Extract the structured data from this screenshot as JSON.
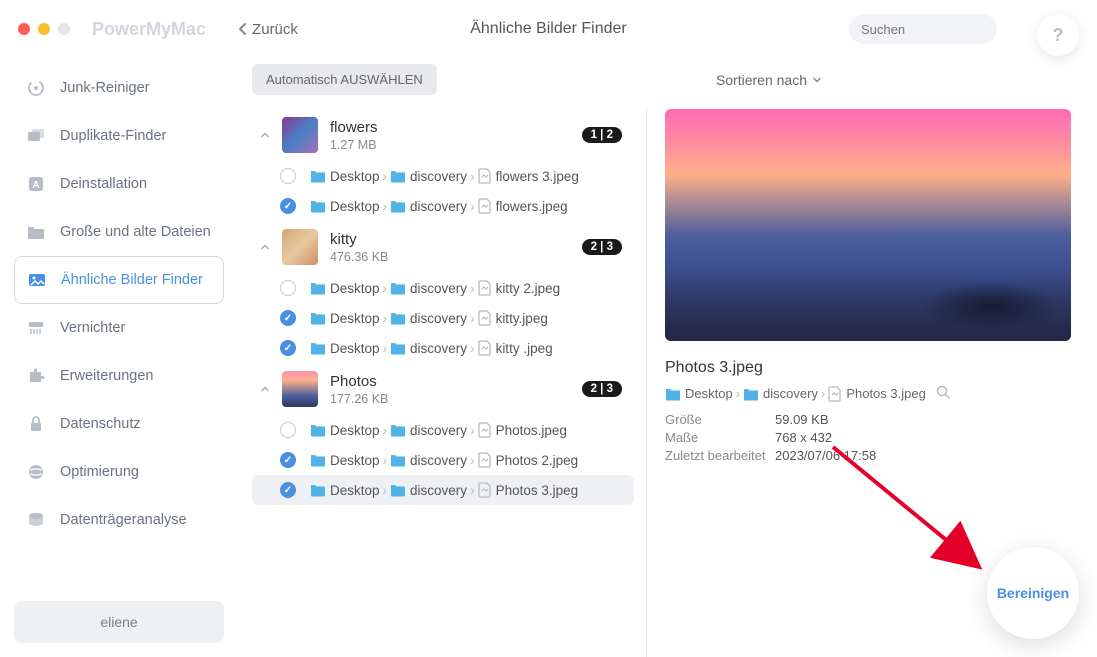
{
  "app_title": "PowerMyMac",
  "back_label": "Zurück",
  "page_title": "Ähnliche Bilder Finder",
  "search_placeholder": "Suchen",
  "help_label": "?",
  "sidebar": {
    "items": [
      {
        "label": "Junk-Reiniger"
      },
      {
        "label": "Duplikate-Finder"
      },
      {
        "label": "Deinstallation"
      },
      {
        "label": "Große und alte Dateien"
      },
      {
        "label": "Ähnliche Bilder Finder"
      },
      {
        "label": "Vernichter"
      },
      {
        "label": "Erweiterungen"
      },
      {
        "label": "Datenschutz"
      },
      {
        "label": "Optimierung"
      },
      {
        "label": "Datenträgeranalyse"
      }
    ],
    "user": "eliene"
  },
  "toolbar": {
    "auto_select": "Automatisch AUSWÄHLEN",
    "sort_by": "Sortieren nach"
  },
  "groups": [
    {
      "name": "flowers",
      "size": "1.27 MB",
      "badge": "1 | 2",
      "files": [
        {
          "checked": false,
          "path": [
            "Desktop",
            "discovery"
          ],
          "file": "flowers 3.jpeg"
        },
        {
          "checked": true,
          "path": [
            "Desktop",
            "discovery"
          ],
          "file": "flowers.jpeg"
        }
      ]
    },
    {
      "name": "kitty",
      "size": "476.36 KB",
      "badge": "2 | 3",
      "files": [
        {
          "checked": false,
          "path": [
            "Desktop",
            "discovery"
          ],
          "file": "kitty 2.jpeg"
        },
        {
          "checked": true,
          "path": [
            "Desktop",
            "discovery"
          ],
          "file": "kitty.jpeg"
        },
        {
          "checked": true,
          "path": [
            "Desktop",
            "discovery"
          ],
          "file": "kitty .jpeg"
        }
      ]
    },
    {
      "name": "Photos",
      "size": "177.26 KB",
      "badge": "2 | 3",
      "files": [
        {
          "checked": false,
          "path": [
            "Desktop",
            "discovery"
          ],
          "file": "Photos.jpeg"
        },
        {
          "checked": true,
          "path": [
            "Desktop",
            "discovery"
          ],
          "file": "Photos 2.jpeg"
        },
        {
          "checked": true,
          "path": [
            "Desktop",
            "discovery"
          ],
          "file": "Photos 3.jpeg",
          "selected": true
        }
      ]
    }
  ],
  "detail": {
    "name": "Photos 3.jpeg",
    "path": [
      "Desktop",
      "discovery",
      "Photos 3.jpeg"
    ],
    "meta": {
      "size_label": "Größe",
      "size_value": "59.09 KB",
      "dims_label": "Maße",
      "dims_value": "768 x 432",
      "mod_label": "Zuletzt bearbeitet",
      "mod_value": "2023/07/06 17:58"
    }
  },
  "clean_button": "Bereinigen"
}
